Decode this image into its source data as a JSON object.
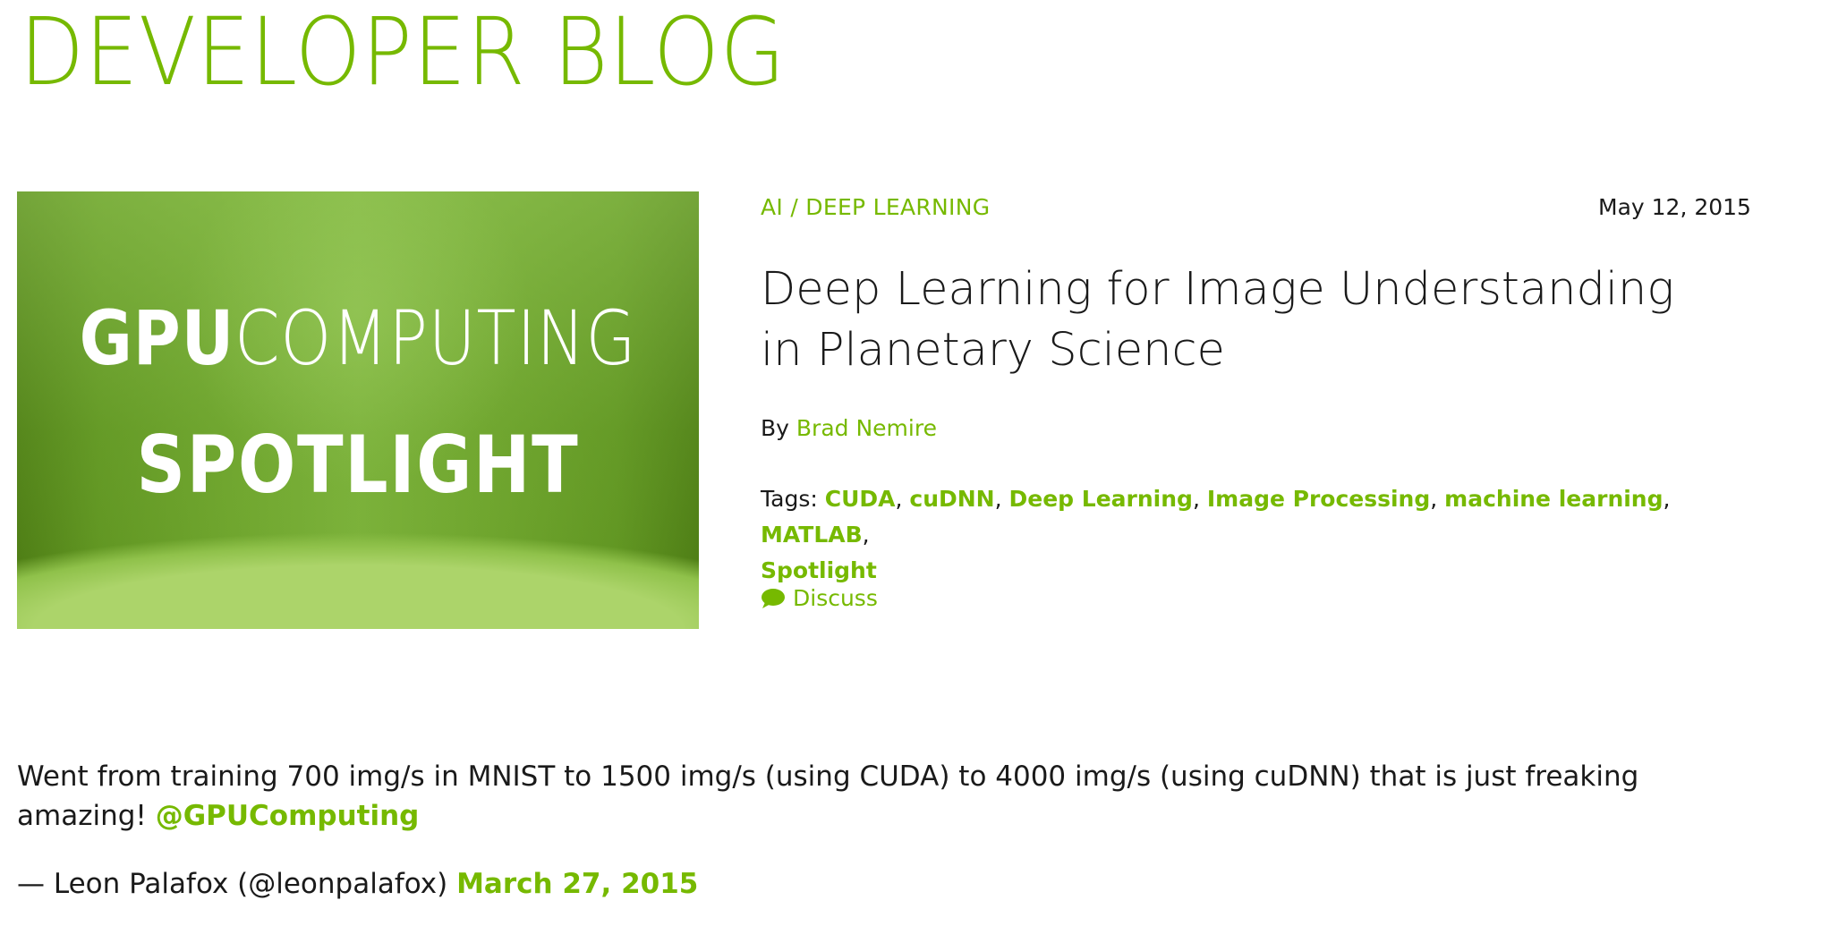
{
  "header": {
    "title": "DEVELOPER BLOG"
  },
  "hero": {
    "line1_bold": "GPU",
    "line1_light": "COMPUTING",
    "line2": "SPOTLIGHT"
  },
  "post": {
    "category": "AI / DEEP LEARNING",
    "date": "May 12, 2015",
    "title": "Deep Learning for Image Understanding in Planetary Science",
    "byline_prefix": "By",
    "author": "Brad Nemire",
    "tags_label": "Tags:",
    "tags": [
      "CUDA",
      "cuDNN",
      "Deep Learning",
      "Image Processing",
      "machine learning",
      "MATLAB",
      "Spotlight"
    ],
    "discuss_label": "Discuss"
  },
  "tweet": {
    "text": "Went from training 700 img/s in MNIST to 1500 img/s (using CUDA) to 4000 img/s (using cuDNN) that is just freaking amazing!",
    "mention": "@GPUComputing",
    "author_line": "— Leon Palafox (@leonpalafox)",
    "date": "March 27, 2015"
  },
  "colors": {
    "accent": "#76b900",
    "text": "#1a1a1a",
    "hero_green": "#5f9420"
  }
}
